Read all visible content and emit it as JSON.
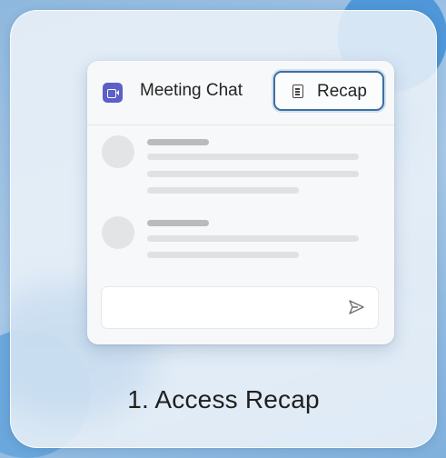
{
  "header": {
    "meeting_chat_label": "Meeting Chat",
    "recap_label": "Recap"
  },
  "caption": "1. Access Recap",
  "icons": {
    "meeting": "video-camera-icon",
    "recap": "document-icon",
    "send": "send-icon"
  },
  "colors": {
    "meeting_icon": "#5b5fc7",
    "recap_tab_border": "#3d6f9e"
  }
}
